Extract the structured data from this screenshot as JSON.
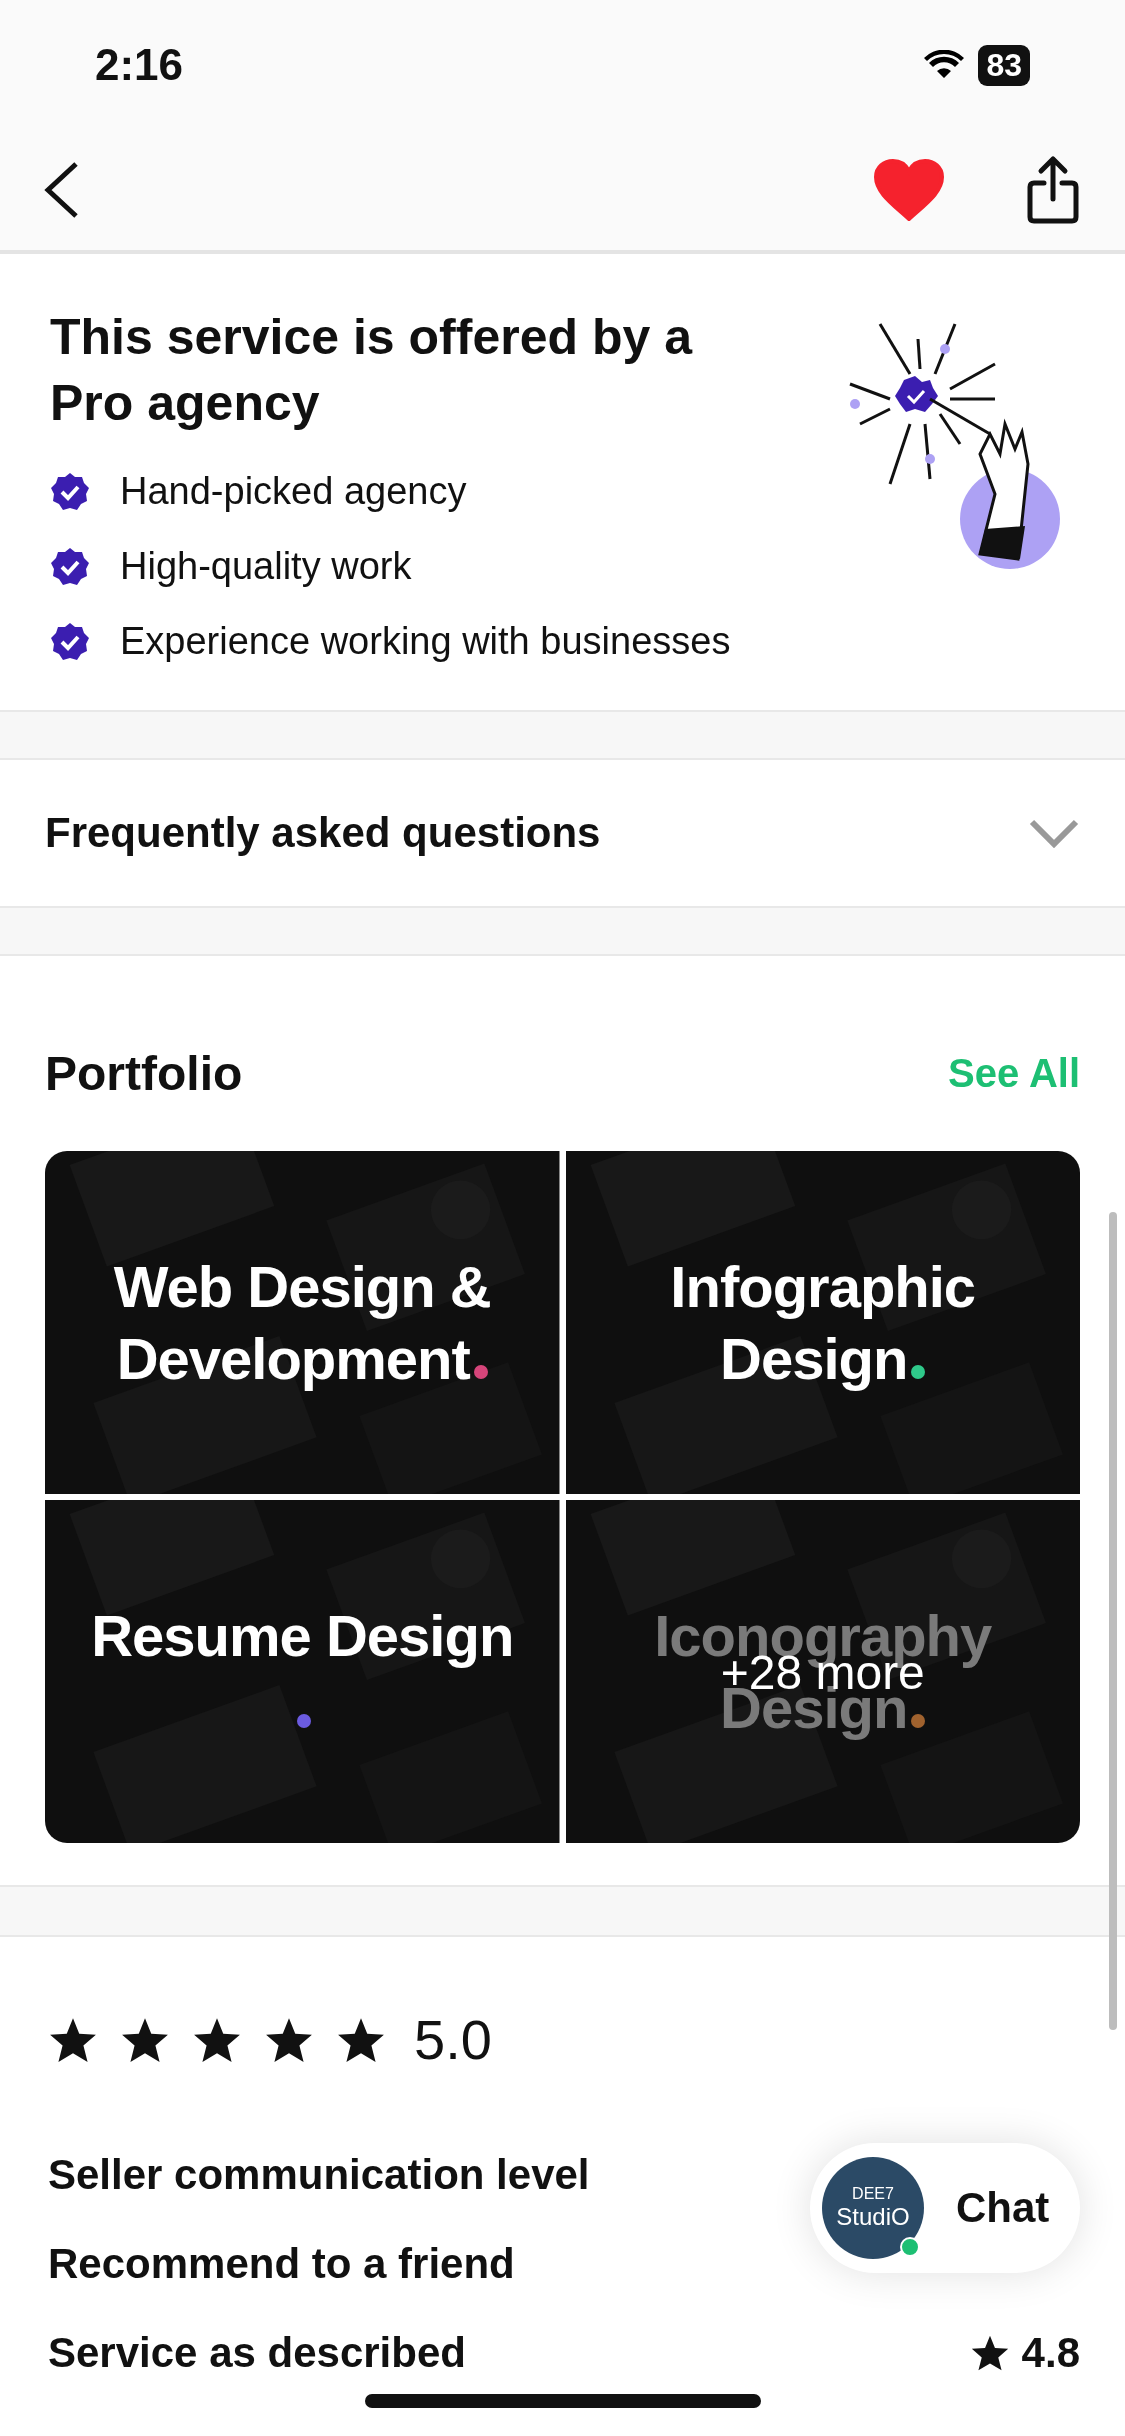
{
  "status_bar": {
    "time": "2:16",
    "battery": "83"
  },
  "nav": {
    "favorite": true
  },
  "pro_agency": {
    "title": "This service is offered by a Pro agency",
    "features": [
      "Hand-picked agency",
      "High-quality work",
      "Experience working with businesses"
    ]
  },
  "faq": {
    "label": "Frequently asked questions",
    "expanded": false
  },
  "portfolio": {
    "title": "Portfolio",
    "see_all": "See All",
    "tiles": [
      {
        "title": "Web Design & Development",
        "color": "#d6457a",
        "dimmed": false
      },
      {
        "title": "Infographic Design",
        "color": "#2fc98a",
        "dimmed": false
      },
      {
        "title": "Resume Design",
        "color": "#6b5be0",
        "dimmed": false
      },
      {
        "title": "Iconography Design",
        "color": "#a0622e",
        "dimmed": true,
        "overlay": "+28 more"
      }
    ]
  },
  "rating": {
    "stars": 5,
    "score": "5.0",
    "rows": [
      {
        "label": "Seller communication level"
      },
      {
        "label": "Recommend to a friend"
      },
      {
        "label": "Service as described",
        "score": "4.8"
      }
    ]
  },
  "chat": {
    "avatar_top": "DEE7",
    "avatar_bottom": "StudiO",
    "label": "Chat",
    "online": true
  }
}
